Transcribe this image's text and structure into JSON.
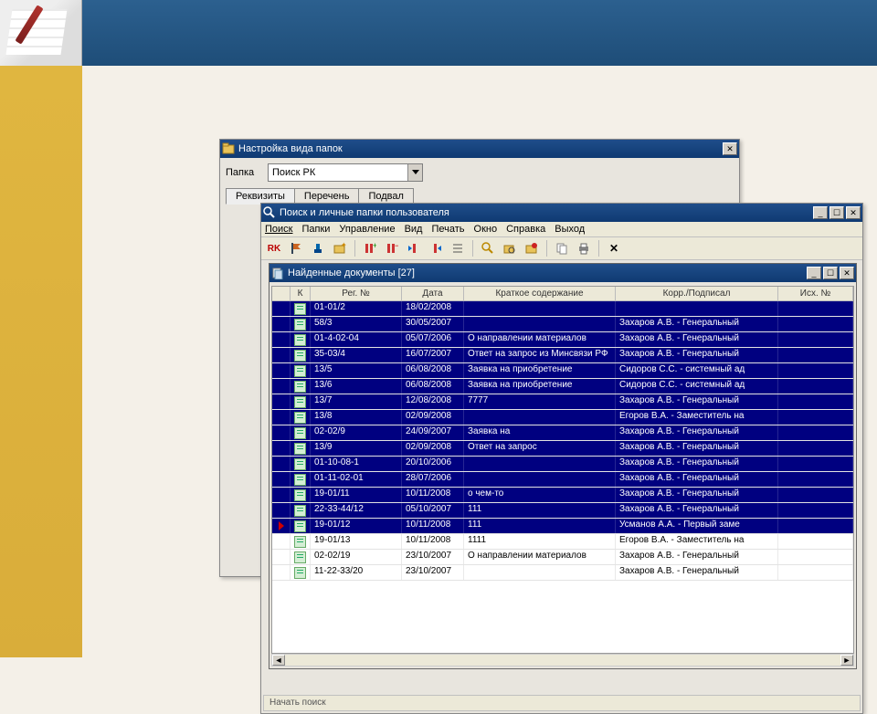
{
  "win1": {
    "title": "Настройка вида папок",
    "folder_label": "Папка",
    "folder_value": "Поиск РК",
    "tabs": [
      "Реквизиты",
      "Перечень",
      "Подвал"
    ],
    "active_tab": 0
  },
  "win2": {
    "title": "Поиск и личные папки пользователя",
    "menu": [
      "Поиск",
      "Папки",
      "Управление",
      "Вид",
      "Печать",
      "Окно",
      "Справка",
      "Выход"
    ],
    "status": "Начать поиск"
  },
  "win3": {
    "title": "Найденные документы  [27]",
    "columns": {
      "k": "К",
      "reg": "Рег. №",
      "date": "Дата",
      "desc": "Краткое содержание",
      "corr": "Корр./Подписал",
      "out": "Исх. №"
    },
    "rows": [
      {
        "sel": true,
        "reg": "01-01/2",
        "date": "18/02/2008",
        "desc": "",
        "corr": ""
      },
      {
        "sel": true,
        "reg": "58/3",
        "date": "30/05/2007",
        "desc": "",
        "corr": "Захаров А.В. - Генеральный"
      },
      {
        "sel": true,
        "reg": "01-4-02-04",
        "date": "05/07/2006",
        "desc": "О направлении материалов",
        "corr": "Захаров А.В. - Генеральный"
      },
      {
        "sel": true,
        "reg": "35-03/4",
        "date": "16/07/2007",
        "desc": "Ответ на запрос из Минсвязи РФ",
        "corr": "Захаров А.В. - Генеральный"
      },
      {
        "sel": true,
        "reg": "13/5",
        "date": "06/08/2008",
        "desc": "Заявка на приобретение",
        "corr": "Сидоров С.С. - системный ад"
      },
      {
        "sel": true,
        "reg": "13/6",
        "date": "06/08/2008",
        "desc": "Заявка на приобретение",
        "corr": "Сидоров С.С. - системный ад"
      },
      {
        "sel": true,
        "reg": "13/7",
        "date": "12/08/2008",
        "desc": "7777",
        "corr": "Захаров А.В. - Генеральный"
      },
      {
        "sel": true,
        "reg": "13/8",
        "date": "02/09/2008",
        "desc": "",
        "corr": "Егоров В.А. - Заместитель на"
      },
      {
        "sel": true,
        "reg": "02-02/9",
        "date": "24/09/2007",
        "desc": "Заявка на",
        "corr": "Захаров А.В. - Генеральный"
      },
      {
        "sel": true,
        "reg": "13/9",
        "date": "02/09/2008",
        "desc": "Ответ на запрос",
        "corr": "Захаров А.В. - Генеральный"
      },
      {
        "sel": true,
        "reg": "01-10-08-1",
        "date": "20/10/2006",
        "desc": "",
        "corr": "Захаров А.В. - Генеральный"
      },
      {
        "sel": true,
        "reg": "01-11-02-01",
        "date": "28/07/2006",
        "desc": "",
        "corr": "Захаров А.В. - Генеральный"
      },
      {
        "sel": true,
        "reg": "19-01/11",
        "date": "10/11/2008",
        "desc": "о чем-то",
        "corr": "Захаров А.В. - Генеральный"
      },
      {
        "sel": true,
        "reg": "22-33-44/12",
        "date": "05/10/2007",
        "desc": "111",
        "corr": "Захаров А.В. - Генеральный"
      },
      {
        "sel": true,
        "cur": true,
        "reg": "19-01/12",
        "date": "10/11/2008",
        "desc": "111",
        "corr": "Усманов А.А. - Первый заме"
      },
      {
        "sel": false,
        "reg": "19-01/13",
        "date": "10/11/2008",
        "desc": "1111",
        "corr": "Егоров В.А. - Заместитель на"
      },
      {
        "sel": false,
        "reg": "02-02/19",
        "date": "23/10/2007",
        "desc": "О направлении материалов",
        "corr": "Захаров А.В. - Генеральный"
      },
      {
        "sel": false,
        "reg": "11-22-33/20",
        "date": "23/10/2007",
        "desc": "",
        "corr": "Захаров А.В. - Генеральный"
      }
    ]
  }
}
